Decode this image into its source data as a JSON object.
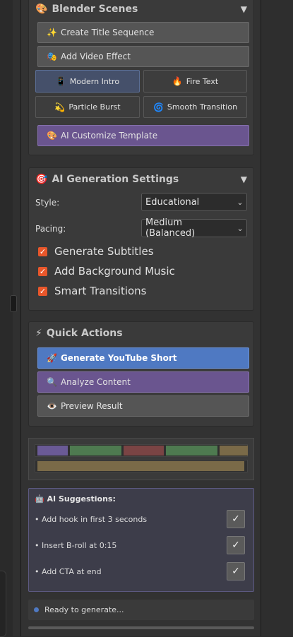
{
  "blender_scenes": {
    "title": "Blender Scenes",
    "icon": "🎨",
    "caret": "▼",
    "buttons": [
      {
        "icon": "✨",
        "label": "Create Title Sequence"
      },
      {
        "icon": "🎭",
        "label": "Add Video Effect"
      }
    ],
    "templates": [
      {
        "icon": "📱",
        "label": "Modern Intro",
        "selected": true
      },
      {
        "icon": "🔥",
        "label": "Fire Text",
        "selected": false
      },
      {
        "icon": "💫",
        "label": "Particle Burst",
        "selected": false
      },
      {
        "icon": "🌀",
        "label": "Smooth Transition",
        "selected": false
      }
    ],
    "customize": {
      "icon": "🎨",
      "label": "AI Customize Template"
    }
  },
  "ai_settings": {
    "title": "AI Generation Settings",
    "icon": "🎯",
    "caret": "▼",
    "style_label": "Style:",
    "style_value": "Educational",
    "pacing_label": "Pacing:",
    "pacing_value": "Medium (Balanced)",
    "checkboxes": [
      {
        "label": "Generate Subtitles",
        "checked": true
      },
      {
        "label": "Add Background Music",
        "checked": true
      },
      {
        "label": "Smart Transitions",
        "checked": true
      }
    ]
  },
  "quick_actions": {
    "title": "Quick Actions",
    "icon": "⚡",
    "generate": {
      "icon": "🚀",
      "label": "Generate YouTube Short"
    },
    "analyze": {
      "icon": "🔍",
      "label": "Analyze Content"
    },
    "preview": {
      "icon": "👁️",
      "label": "Preview Result"
    }
  },
  "timeline": {
    "clip_colors": [
      "#6a5a96",
      "#4e7a50",
      "#7a4444",
      "#4e7a50",
      "#7a6a48"
    ],
    "audio_color": "#7a6a48"
  },
  "suggestions": {
    "title": "AI Suggestions:",
    "icon": "🤖",
    "items": [
      {
        "text": "• Add hook in first 3 seconds",
        "action": "✓"
      },
      {
        "text": "• Insert B-roll at 0:15",
        "action": "✓"
      },
      {
        "text": "• Add CTA at end",
        "action": "✓"
      }
    ]
  },
  "status": {
    "text": "Ready to generate...",
    "dot_color": "#4f79c2"
  }
}
